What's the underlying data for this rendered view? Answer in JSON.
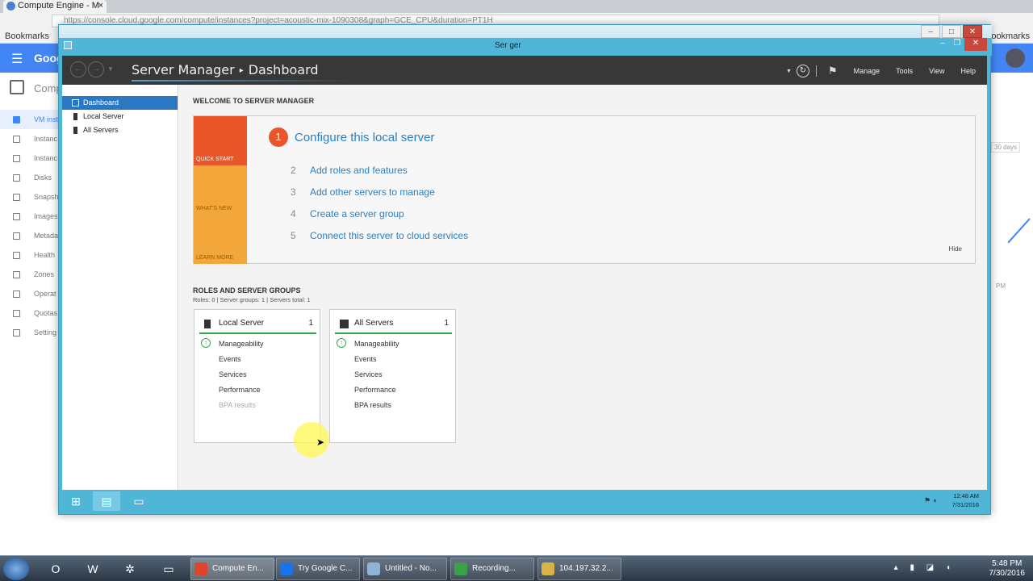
{
  "browser": {
    "tab_title": "Compute Engine - M",
    "tab_close": "×",
    "url": "https://console.cloud.google.com/compute/instances?project=acoustic-mix-1090308&graph=GCE_CPU&duration=PT1H",
    "bookmarks_label": "Bookmarks",
    "other_bookmarks": "bookmarks"
  },
  "gcp": {
    "brand": "Goog",
    "section": "Comp",
    "nav": [
      {
        "label": "VM inst",
        "active": true
      },
      {
        "label": "Instanc"
      },
      {
        "label": "Instanc"
      },
      {
        "label": "Disks"
      },
      {
        "label": "Snapsh"
      },
      {
        "label": "Images"
      },
      {
        "label": "Metada"
      },
      {
        "label": "Health"
      },
      {
        "label": "Zones"
      },
      {
        "label": "Operat"
      },
      {
        "label": "Quotas"
      },
      {
        "label": "Setting"
      }
    ],
    "right_days": "30 days",
    "right_pm": "PM"
  },
  "rdp": {
    "title": "Ser...ger",
    "inner_title": "Ser ger",
    "taskbar_clock_time": "12:48 AM",
    "taskbar_clock_date": "7/31/2016"
  },
  "server_manager": {
    "breadcrumb_app": "Server Manager",
    "breadcrumb_sep": "▸",
    "breadcrumb_page": "Dashboard",
    "menu": [
      "Manage",
      "Tools",
      "View",
      "Help"
    ],
    "sidebar": [
      {
        "label": "Dashboard",
        "active": true
      },
      {
        "label": "Local Server"
      },
      {
        "label": "All Servers"
      }
    ],
    "welcome_title": "WELCOME TO SERVER MANAGER",
    "tiles": {
      "quick_start": "QUICK START",
      "whats_new": "WHAT'S NEW",
      "learn_more": "LEARN MORE"
    },
    "step1_num": "1",
    "step1_label": "Configure this local server",
    "steps": [
      {
        "num": "2",
        "label": "Add roles and features"
      },
      {
        "num": "3",
        "label": "Add other servers to manage"
      },
      {
        "num": "4",
        "label": "Create a server group"
      },
      {
        "num": "5",
        "label": "Connect this server to cloud services"
      }
    ],
    "hide": "Hide",
    "roles_title": "ROLES AND SERVER GROUPS",
    "roles_summary": "Roles: 0   |   Server groups: 1   |   Servers total: 1",
    "cards": [
      {
        "name": "Local Server",
        "count": "1",
        "rows": [
          "Manageability",
          "Events",
          "Services",
          "Performance",
          "BPA results"
        ]
      },
      {
        "name": "All Servers",
        "count": "1",
        "rows": [
          "Manageability",
          "Events",
          "Services",
          "Performance",
          "BPA results"
        ]
      }
    ]
  },
  "windows_taskbar": {
    "tasks": [
      {
        "label": "Compute En...",
        "color": "#e0442b"
      },
      {
        "label": "Try Google C...",
        "color": "#1a73e8"
      },
      {
        "label": "Untitled - No...",
        "color": "#8fb4d8"
      },
      {
        "label": "Recording...",
        "color": "#3aa14a"
      },
      {
        "label": "104.197.32.2...",
        "color": "#d9b24a"
      }
    ],
    "clock_time": "5:48 PM",
    "clock_date": "7/30/2016"
  }
}
